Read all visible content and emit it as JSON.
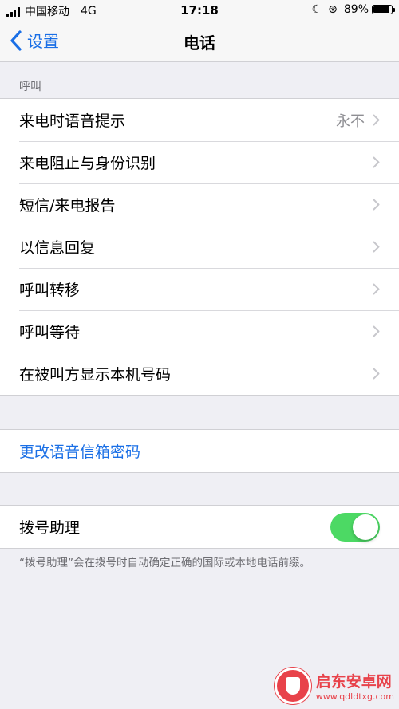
{
  "status_bar": {
    "carrier": "中国移动",
    "network": "4G",
    "time": "17:18",
    "battery": "89%",
    "battery_level": 0.89
  },
  "nav": {
    "back_label": "设置",
    "title": "电话"
  },
  "calls_section": {
    "header": "呼叫",
    "items": [
      {
        "label": "来电时语音提示",
        "detail": "永不"
      },
      {
        "label": "来电阻止与身份识别"
      },
      {
        "label": "短信/来电报告"
      },
      {
        "label": "以信息回复"
      },
      {
        "label": "呼叫转移"
      },
      {
        "label": "呼叫等待"
      },
      {
        "label": "在被叫方显示本机号码"
      }
    ]
  },
  "voicemail": {
    "link_label": "更改语音信箱密码"
  },
  "dial_assist": {
    "label": "拨号助理",
    "enabled": true,
    "note": "“拨号助理”会在拨号时自动确定正确的国际或本地电话前缀。"
  },
  "watermark": {
    "name": "启东安卓网",
    "url": "www.qdldtxg.com"
  },
  "colors": {
    "accent": "#1a6fe6",
    "toggle_on": "#4cd964",
    "background": "#efeff4"
  }
}
